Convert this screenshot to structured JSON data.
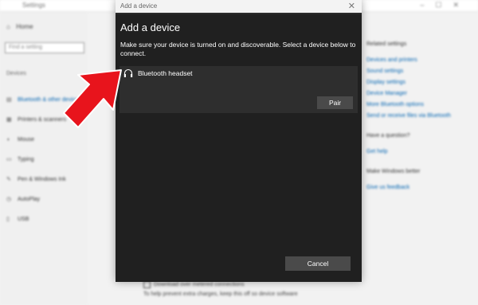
{
  "background": {
    "app_title": "Settings",
    "home_label": "Home",
    "search_placeholder": "Find a setting",
    "section_label": "Devices",
    "nav_items": [
      {
        "label": "Bluetooth & other devices",
        "icon": "bluetooth-icon",
        "active": true
      },
      {
        "label": "Printers & scanners",
        "icon": "printer-icon",
        "active": false
      },
      {
        "label": "Mouse",
        "icon": "mouse-icon",
        "active": false
      },
      {
        "label": "Typing",
        "icon": "keyboard-icon",
        "active": false
      },
      {
        "label": "Pen & Windows Ink",
        "icon": "pen-icon",
        "active": false
      },
      {
        "label": "AutoPlay",
        "icon": "autoplay-icon",
        "active": false
      },
      {
        "label": "USB",
        "icon": "usb-icon",
        "active": false
      }
    ],
    "related_heading": "Related settings",
    "related_links": [
      "Devices and printers",
      "Sound settings",
      "Display settings",
      "Device Manager",
      "More Bluetooth options",
      "Send or receive files via Bluetooth"
    ],
    "question_heading": "Have a question?",
    "question_link": "Get help",
    "improve_heading": "Make Windows better",
    "improve_link": "Give us feedback",
    "bottom_checkbox_label": "Download over metered connections",
    "bottom_note": "To help prevent extra charges, keep this off so device software"
  },
  "dialog": {
    "title": "Add a device",
    "heading": "Add a device",
    "description": "Make sure your device is turned on and discoverable. Select a device below to connect.",
    "device": {
      "name": "Bluetooth headset",
      "icon": "headphones-icon"
    },
    "pair_label": "Pair",
    "cancel_label": "Cancel",
    "close_glyph": "✕"
  },
  "colors": {
    "dialog_bg": "#202020",
    "card_bg": "#2e2e2e",
    "button_bg": "#4a4a4a",
    "annotation_red": "#e8141c"
  }
}
